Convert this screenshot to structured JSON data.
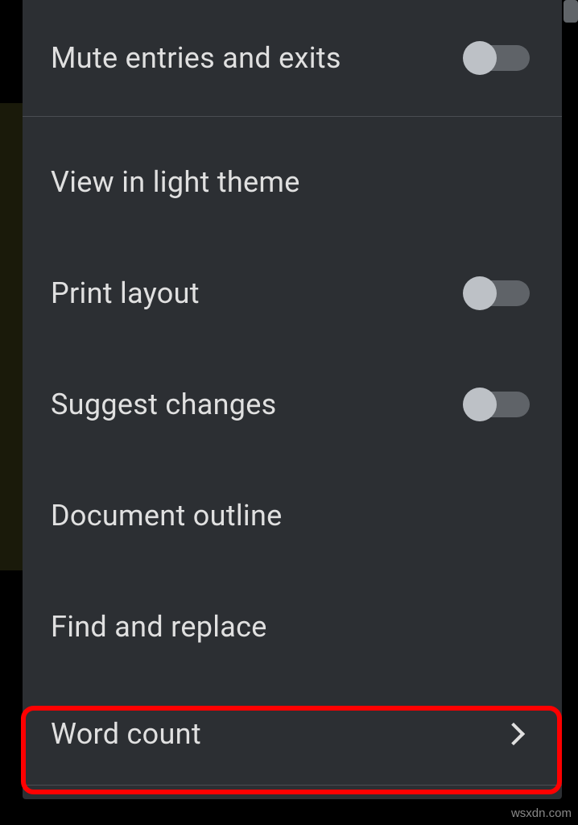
{
  "menu": {
    "mute_entries_exits": "Mute entries and exits",
    "view_light_theme": "View in light theme",
    "print_layout": "Print layout",
    "suggest_changes": "Suggest changes",
    "document_outline": "Document outline",
    "find_replace": "Find and replace",
    "word_count": "Word count"
  },
  "toggles": {
    "mute_entries_exits": false,
    "print_layout": false,
    "suggest_changes": false
  },
  "watermark": "wsxdn.com"
}
